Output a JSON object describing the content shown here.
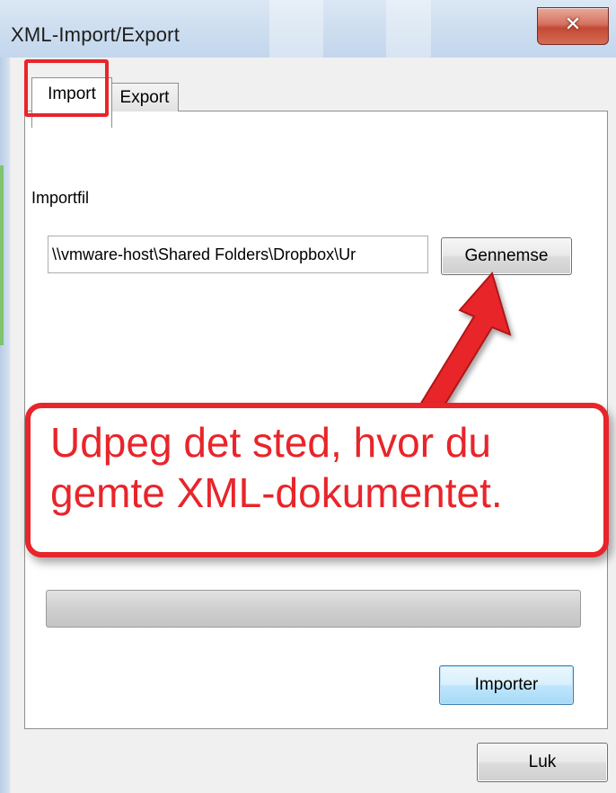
{
  "window": {
    "title": "XML-Import/Export",
    "close_icon": "✕"
  },
  "tabs": [
    {
      "label": "Import",
      "selected": true
    },
    {
      "label": "Export",
      "selected": false
    }
  ],
  "import_panel": {
    "file_label": "Importfil",
    "file_path": "\\\\vmware-host\\Shared Folders\\Dropbox\\Ur",
    "browse_label": "Gennemse",
    "progress_value": 0,
    "import_label": "Importer"
  },
  "footer": {
    "close_label": "Luk"
  },
  "annotation": {
    "text": "Udpeg det sted, hvor du gemte XML-dokumentet.",
    "color": "#e8252a"
  },
  "icons": {
    "close": "close-icon",
    "arrow": "arrow-icon"
  }
}
